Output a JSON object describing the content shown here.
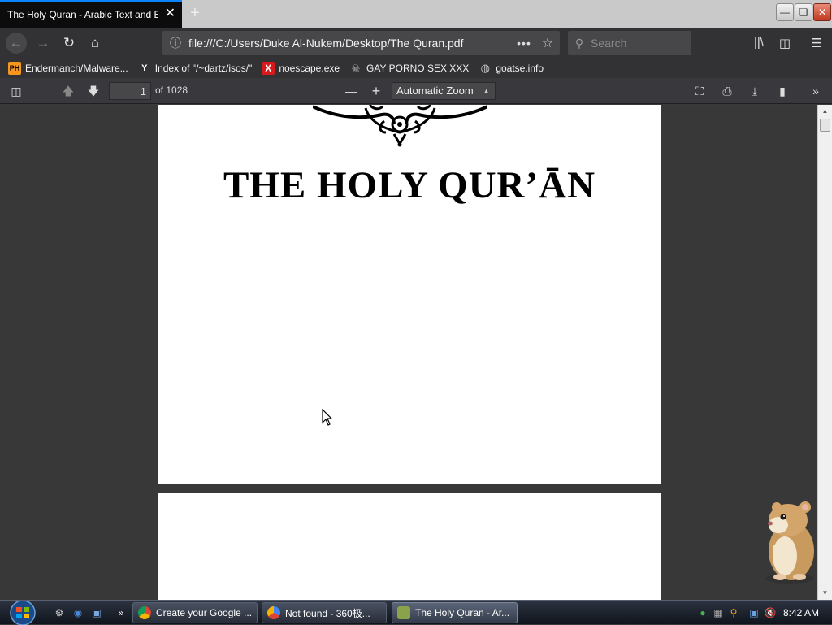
{
  "browser": {
    "tab_title": "The Holy Quran - Arabic Text and English Translation",
    "close_tab": "✕",
    "new_tab": "+",
    "url": "file:///C:/Users/Duke Al-Nukem/Desktop/The Quran.pdf",
    "page_actions": "•••",
    "search_placeholder": "Search"
  },
  "bookmarks": [
    {
      "icon_text": "PH",
      "label": "Endermanch/Malware..."
    },
    {
      "icon_text": "Y",
      "label": "Index of \"/~dartz/isos/\""
    },
    {
      "icon_text": "X",
      "label": "noescape.exe"
    },
    {
      "icon_text": "☠",
      "label": "GAY PORNO SEX XXX"
    },
    {
      "icon_text": "◍",
      "label": "goatse.info"
    }
  ],
  "pdf_toolbar": {
    "page_number": "1",
    "page_count": "of 1028",
    "zoom": "Automatic Zoom"
  },
  "document": {
    "title": "THE HOLY QUR’ĀN"
  },
  "taskbar": {
    "items": [
      {
        "label": "Create your Google ...",
        "icon_color": "#e8c23a"
      },
      {
        "label": "Not found - 360极...",
        "icon_color": "#4285f4"
      },
      {
        "label": "The Holy Quran - Ar...",
        "icon_color": "#8aa34a"
      }
    ],
    "chevron": "»",
    "time": "8:42 AM"
  }
}
